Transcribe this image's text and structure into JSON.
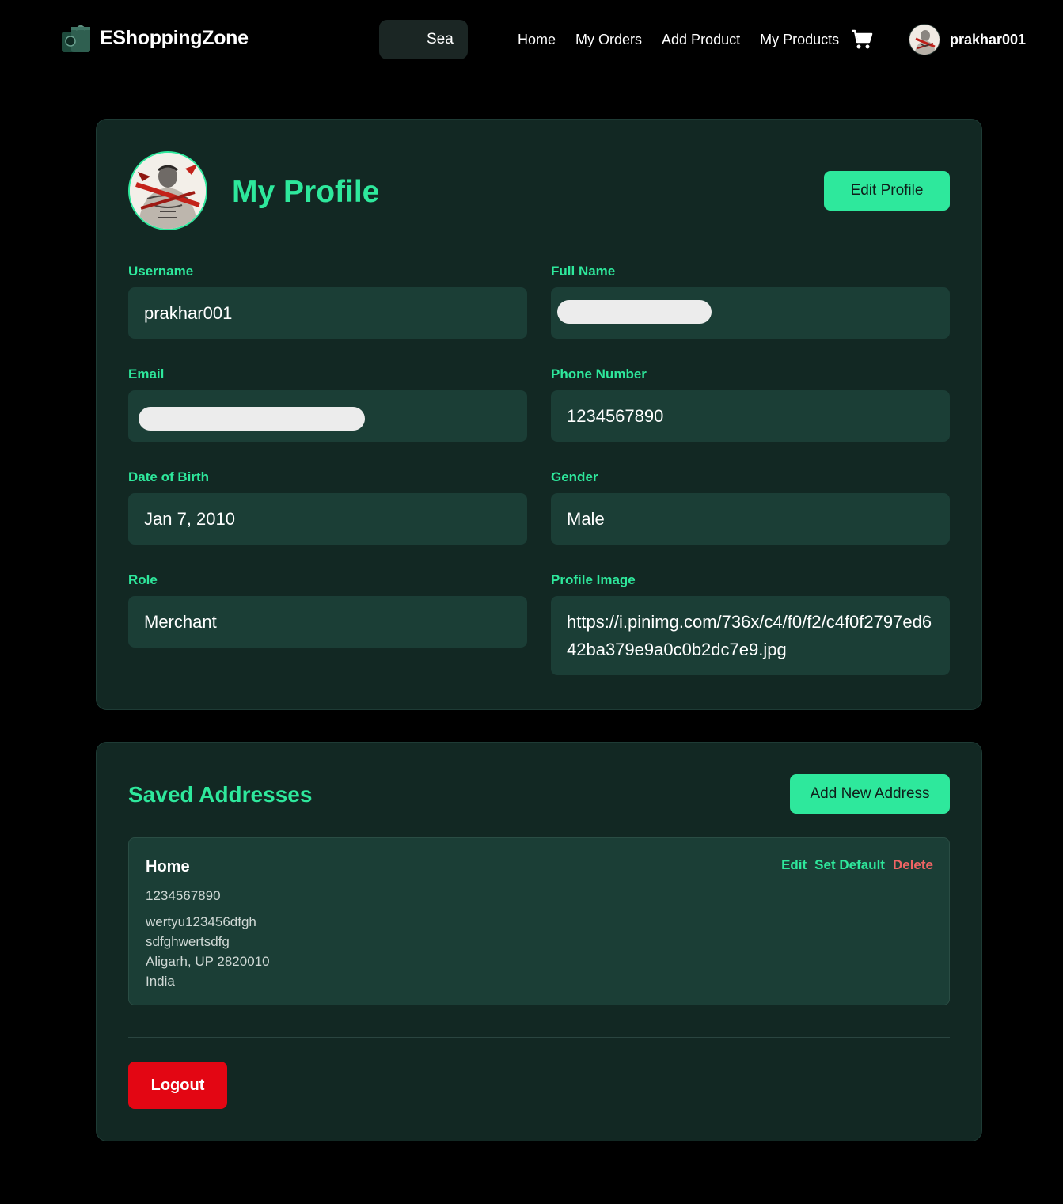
{
  "app": {
    "brand": "EShoppingZone"
  },
  "navbar": {
    "search_placeholder": "Sea",
    "links": [
      "Home",
      "My Orders",
      "Add Product",
      "My Products"
    ],
    "username": "prakhar001"
  },
  "profile": {
    "title": "My Profile",
    "edit_button": "Edit Profile",
    "fields": {
      "username": {
        "label": "Username",
        "value": "prakhar001"
      },
      "full_name": {
        "label": "Full Name",
        "value": ""
      },
      "email": {
        "label": "Email",
        "value": ""
      },
      "phone": {
        "label": "Phone Number",
        "value": "1234567890"
      },
      "dob": {
        "label": "Date of Birth",
        "value": "Jan 7, 2010"
      },
      "gender": {
        "label": "Gender",
        "value": "Male"
      },
      "role": {
        "label": "Role",
        "value": "Merchant"
      },
      "image": {
        "label": "Profile Image",
        "value": "https://i.pinimg.com/736x/c4/f0/f2/c4f0f2797ed642ba379e9a0c0b2dc7e9.jpg"
      }
    }
  },
  "addresses": {
    "title": "Saved Addresses",
    "add_button": "Add New Address",
    "items": [
      {
        "label": "Home",
        "phone": "1234567890",
        "line1": "wertyu123456dfgh",
        "line2": "sdfghwertsdfg",
        "city_line": "Aligarh, UP 2820010",
        "country": "India",
        "actions": {
          "edit": "Edit",
          "set_default": "Set Default",
          "delete": "Delete"
        }
      }
    ]
  },
  "logout_button": "Logout",
  "colors": {
    "accent": "#2ee89c",
    "card_bg": "#122823",
    "field_bg": "#1b3e36",
    "danger": "#e30613",
    "delete_text": "#f06464"
  }
}
